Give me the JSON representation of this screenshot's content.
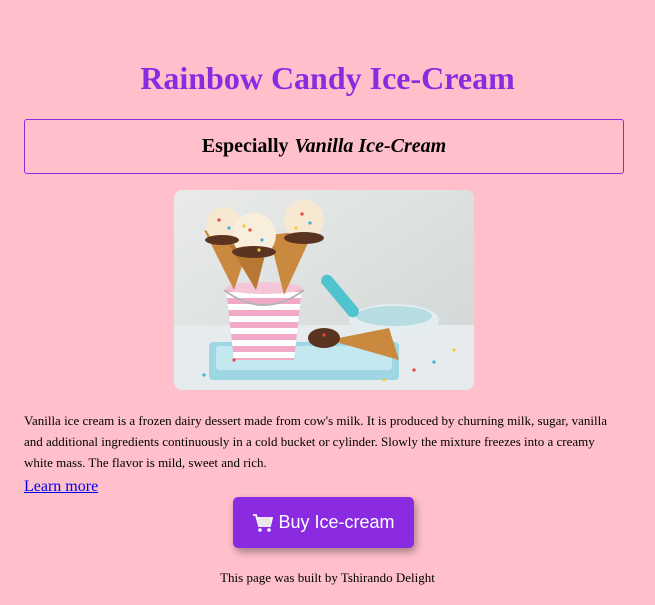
{
  "header": {
    "title": "Rainbow Candy Ice-Cream",
    "subtitle_prefix": "Especially",
    "subtitle_emphasis": "Vanilla Ice-Cream"
  },
  "hero": {
    "alt": "ice cream cones in a striped bucket"
  },
  "description": "Vanilla ice cream is a frozen dairy dessert made from cow's milk. It is produced by churning milk, sugar, vanilla and additional ingredients continuously in a cold bucket or cylinder. Slowly the mixture freezes into a creamy white mass. The flavor is mild, sweet and rich.",
  "learn_more": "Learn more",
  "buy": {
    "label": "Buy Ice-cream",
    "icon": "cart-icon"
  },
  "footer": "This page was built by Tshirando Delight",
  "colors": {
    "background": "#ffc0cb",
    "accent": "#8a2be2",
    "link": "#0000ee"
  }
}
